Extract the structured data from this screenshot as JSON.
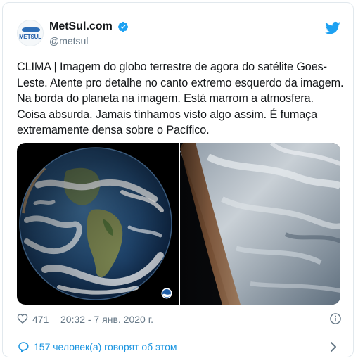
{
  "account": {
    "display_name": "MetSul.com",
    "handle": "@metsul",
    "avatar_text": "METSUL"
  },
  "tweet": {
    "text": "CLIMA | Imagem do globo terrestre de agora do satélite Goes-Leste. Atente pro detalhe no canto extremo esquerdo da imagem. Na borda do planeta na imagem. Está marrom a atmosfera. Coisa absurda. Jamais tínhamos visto algo assim. É fumaça extremamente densa sobre o Pacífico.",
    "likes": "471",
    "timestamp": "20:32 - 7 янв. 2020 г."
  },
  "footer": {
    "discussion": "157 человек(а) говорят об этом"
  },
  "icons": {
    "verified": "verified-badge-icon",
    "brand": "twitter-bird-icon",
    "like": "heart-icon",
    "info": "info-icon",
    "comments": "speech-bubble-icon",
    "chevron": "chevron-right-icon",
    "media_badge": "noaa-logo-icon"
  },
  "colors": {
    "link_blue": "#1b95e0",
    "twitter_blue": "#1da1f2",
    "text": "#14171a",
    "muted": "#657786",
    "border": "#e1e8ed"
  }
}
